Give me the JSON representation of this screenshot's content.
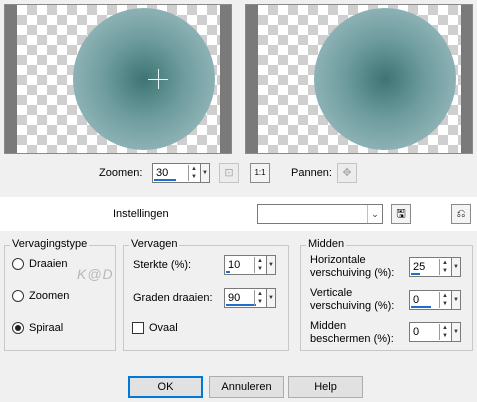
{
  "preview": {
    "zoom_label": "Zoomen:",
    "zoom_value": "30",
    "pan_label": "Pannen:"
  },
  "settings": {
    "label": "Instellingen",
    "value": ""
  },
  "blend_type": {
    "title": "Vervagingstype",
    "options": [
      {
        "label": "Draaien",
        "checked": false
      },
      {
        "label": "Zoomen",
        "checked": false
      },
      {
        "label": "Spiraal",
        "checked": true
      }
    ]
  },
  "blur": {
    "title": "Vervagen",
    "strength_label": "Sterkte (%):",
    "strength_value": "10",
    "rotate_label": "Graden draaien:",
    "rotate_value": "90",
    "oval_label": "Ovaal"
  },
  "center": {
    "title": "Midden",
    "h_label_1": "Horizontale",
    "h_label_2": "verschuiving (%):",
    "h_value": "25",
    "v_label_1": "Verticale",
    "v_label_2": "verschuiving (%):",
    "v_value": "0",
    "p_label_1": "Midden",
    "p_label_2": "beschermen (%):",
    "p_value": "0"
  },
  "buttons": {
    "ok": "OK",
    "cancel": "Annuleren",
    "help": "Help"
  },
  "watermark_text": "K@D"
}
